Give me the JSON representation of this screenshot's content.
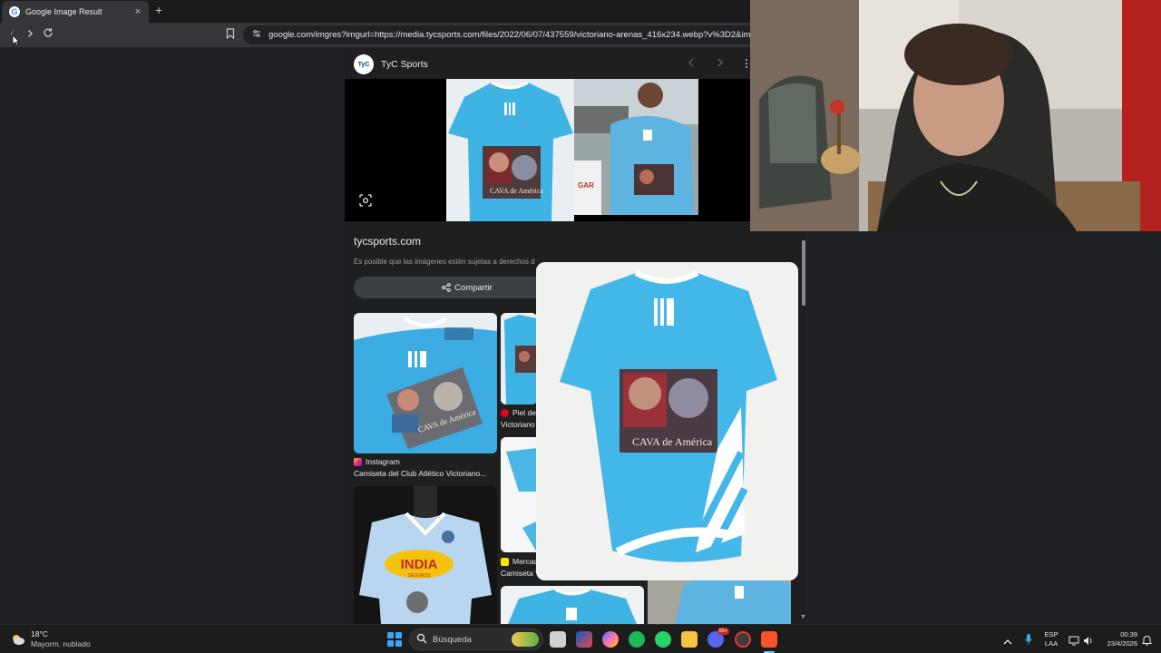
{
  "browser": {
    "tab_title": "Google Image Result",
    "tab_favicon": "G",
    "new_tab_label": "+",
    "close_label": "×",
    "url": "google.com/imgres?imgurl=https://media.tycsports.com/files/2022/06/07/437559/victoriano-arenas_416x234.webp?v%3D2&img"
  },
  "panel": {
    "source_initials": "TyC",
    "source_name": "TyC Sports",
    "domain": "tycsports.com",
    "disclaimer": "Es posible que las imágenes estén sujetas a derechos d",
    "share_label": "Compartir",
    "related": [
      {
        "source": "Instagram",
        "title": "Camiseta del Club Atlético Victoriano..."
      },
      {
        "source": "Piel de",
        "title": "Victoriano"
      },
      {
        "source": "Mercado Libre",
        "title": "Camiseta Victoriano Arenas Titular For..."
      }
    ],
    "shirt_print_text": "CAVA de América",
    "india_shirt": {
      "logo": "INDIA",
      "sub": "SEGUROS"
    }
  },
  "taskbar": {
    "weather_temp": "18°C",
    "weather_desc": "Mayorm. nublado",
    "search_placeholder": "Búsqueda",
    "discord_badge": "99+",
    "lang_line1": "ESP",
    "lang_line2": "LAA",
    "time": "00:39",
    "date": "23/4/2026"
  },
  "colors": {
    "shirt_blue": "#3fb3e3",
    "dark_bg": "#202124",
    "accent_blue": "#3ca8f5"
  }
}
